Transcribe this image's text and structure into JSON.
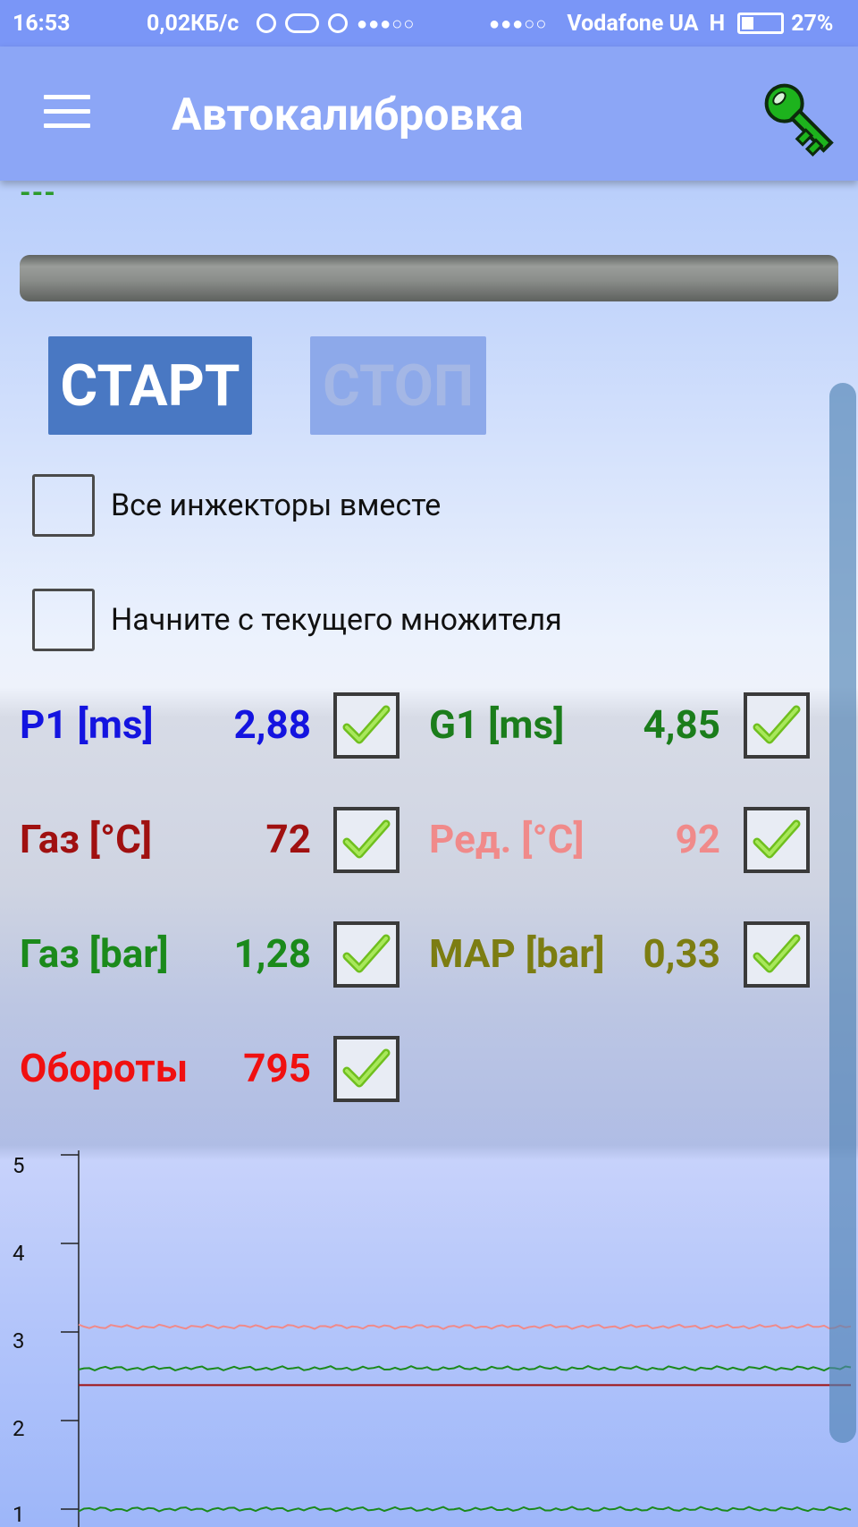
{
  "status_bar": {
    "time": "16:53",
    "speed": "0,02КБ/с",
    "signal1": "●●●○○",
    "signal2": "●●●○○",
    "carrier": "Vodafone UA",
    "network": "H",
    "battery": "27%"
  },
  "app_bar": {
    "title": "Автокалибровка",
    "menu_icon": "hamburger-menu-icon",
    "key_icon": "green-key-icon",
    "key_color": "#1db31d"
  },
  "status_text": "---",
  "buttons": {
    "start": "СТАРТ",
    "stop": "СТОП"
  },
  "options": [
    {
      "label": "Все инжекторы вместе",
      "checked": false
    },
    {
      "label": "Начните с текущего множителя",
      "checked": false
    }
  ],
  "parameters": [
    {
      "label": "P1 [ms]",
      "value": "2,88",
      "color": "#1414e0",
      "checked": true
    },
    {
      "label": "G1 [ms]",
      "value": "4,85",
      "color": "#1b7d1b",
      "checked": true
    },
    {
      "label": "Газ [°C]",
      "value": "72",
      "color": "#a01010",
      "checked": true
    },
    {
      "label": "Ред. [°C]",
      "value": "92",
      "color": "#f08a8a",
      "checked": true
    },
    {
      "label": "Газ [bar]",
      "value": "1,28",
      "color": "#1b8a1b",
      "checked": true
    },
    {
      "label": "MAP [bar]",
      "value": "0,33",
      "color": "#7c7d12",
      "checked": true
    },
    {
      "label": "Обороты",
      "value": "795",
      "color": "#f01010",
      "checked": true
    }
  ],
  "chart_data": {
    "type": "line",
    "y_ticks": [
      "5",
      "4",
      "3",
      "2",
      "1"
    ],
    "ylim": [
      1,
      5
    ],
    "series": [
      {
        "color": "#f08a8a",
        "level": 3.06
      },
      {
        "color": "#1b8a1b",
        "level": 2.59
      },
      {
        "color": "#a01010",
        "level": 2.4
      },
      {
        "color": "#1b8a1b",
        "level": 1.0
      }
    ]
  }
}
